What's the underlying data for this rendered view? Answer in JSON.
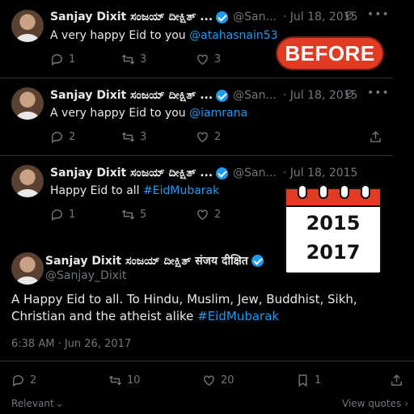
{
  "author": {
    "name": "Sanjay Dixit ಸಂಜಯ್ ದೀಕ್ಷಿತ್ ...",
    "full_name": "Sanjay Dixit ಸಂಜಯ್ ದೀಕ್ಷಿತ್ संजय दीक्षित",
    "handle_short": "@San...",
    "handle": "@Sanjay_Dixit"
  },
  "tweets": [
    {
      "date": "· Jul 18, 2015",
      "text": "A very happy Eid to you ",
      "mention": "@atahasnain53",
      "replies": "1",
      "retweets": "3",
      "likes": "3"
    },
    {
      "date": "· Jul 18, 2015",
      "text": "A very happy Eid to you ",
      "mention": "@iamrana",
      "replies": "2",
      "retweets": "3",
      "likes": "2"
    },
    {
      "date": "· Jul 18, 2015",
      "text": "Happy Eid to all ",
      "mention": "#EidMubarak",
      "replies": "1",
      "retweets": "5",
      "likes": "2"
    }
  ],
  "main_tweet": {
    "text": "A Happy Eid to all. To Hindu, Muslim, Jew, Buddhist, Sikh, Christian and the atheist alike ",
    "hashtag": "#EidMubarak",
    "timestamp": "6:38 AM · Jun 26, 2017",
    "replies": "2",
    "retweets": "10",
    "likes": "20",
    "bookmarks": "1"
  },
  "footer": {
    "relevant": "Relevant",
    "view_quotes": "View quotes"
  },
  "overlay": {
    "before_label": "BEFORE",
    "year1": "2015",
    "year2": "2017"
  },
  "colors": {
    "accent": "#1d9bf0",
    "muted": "#71767b",
    "badge_red": "#e23b24"
  }
}
